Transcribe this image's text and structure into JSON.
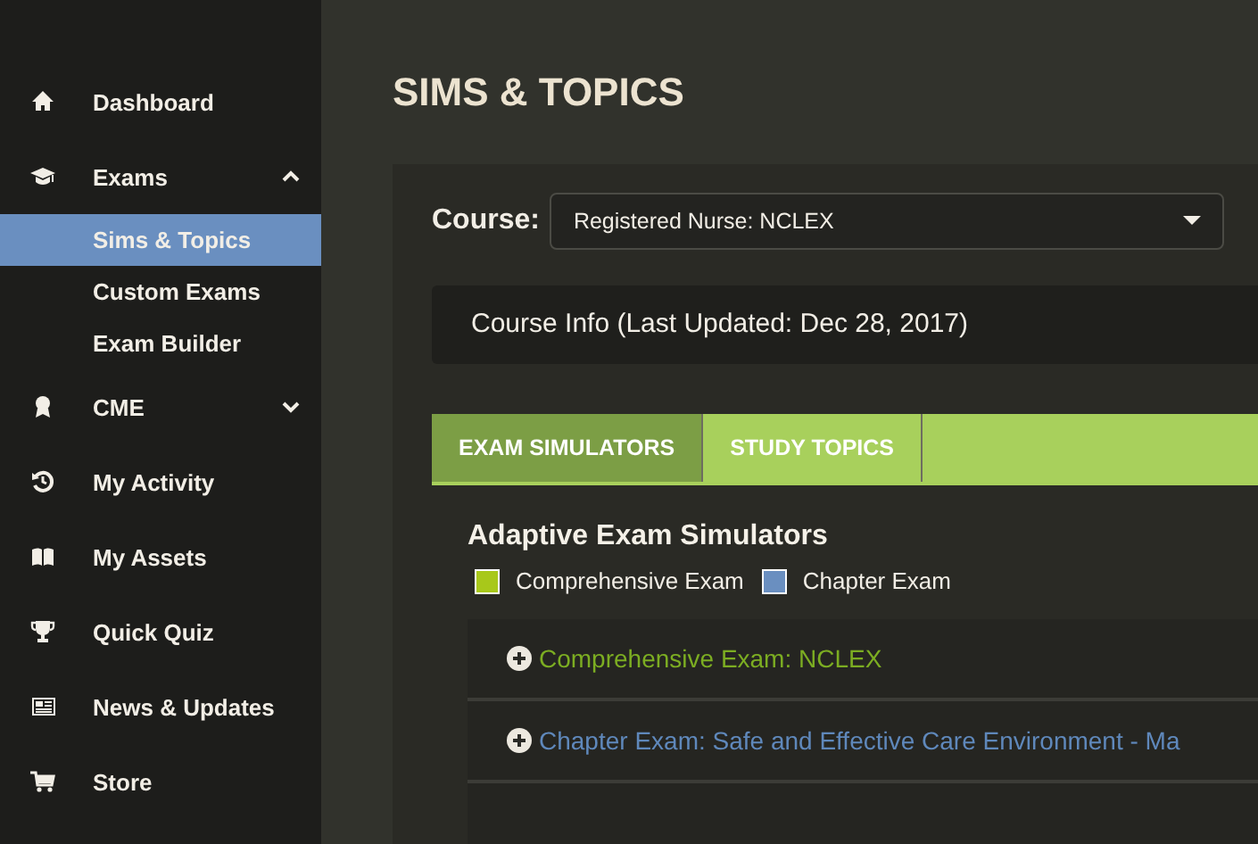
{
  "sidebar": {
    "items": [
      {
        "label": "Dashboard"
      },
      {
        "label": "Exams",
        "expanded": true,
        "children": [
          {
            "label": "Sims & Topics",
            "selected": true
          },
          {
            "label": "Custom Exams",
            "selected": false
          },
          {
            "label": "Exam Builder",
            "selected": false
          }
        ]
      },
      {
        "label": "CME",
        "expanded": false
      },
      {
        "label": "My Activity"
      },
      {
        "label": "My Assets"
      },
      {
        "label": "Quick Quiz"
      },
      {
        "label": "News & Updates"
      },
      {
        "label": "Store"
      }
    ]
  },
  "page_title": "SIMS & TOPICS",
  "course": {
    "label": "Course:",
    "value": "Registered Nurse: NCLEX"
  },
  "course_info": "Course Info (Last Updated: Dec 28, 2017)",
  "tabs": [
    {
      "label": "EXAM SIMULATORS",
      "selected": true
    },
    {
      "label": "STUDY TOPICS",
      "selected": false
    }
  ],
  "section_title": "Adaptive Exam Simulators",
  "legend": [
    {
      "label": "Comprehensive Exam",
      "color": "#a8c81a"
    },
    {
      "label": "Chapter Exam",
      "color": "#6a8fc0"
    }
  ],
  "exams": [
    {
      "label": "Comprehensive Exam: NCLEX",
      "color": "#7cad22"
    },
    {
      "label": "Chapter Exam: Safe and Effective Care Environment - Ma",
      "color": "#5f88bb"
    }
  ]
}
